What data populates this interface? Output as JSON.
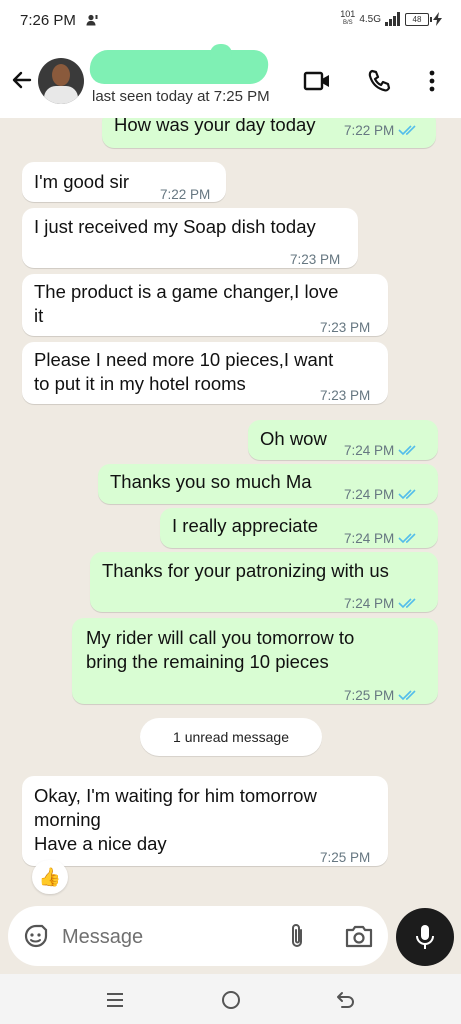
{
  "status_bar": {
    "time": "7:26 PM",
    "speed_top": "101",
    "speed_bottom": "B/S",
    "network": "4.5G",
    "battery": "48"
  },
  "header": {
    "last_seen": "last seen today at 7:25 PM",
    "icons": [
      "back-arrow-icon",
      "video-call-icon",
      "phone-icon",
      "more-vert-icon"
    ]
  },
  "messages": [
    {
      "dir": "out",
      "text": "How was your day today",
      "time": "7:22 PM",
      "read": true
    },
    {
      "dir": "in",
      "text": "I'm good sir",
      "time": "7:22 PM"
    },
    {
      "dir": "in",
      "text": "I just received my Soap dish today",
      "time": "7:23 PM"
    },
    {
      "dir": "in",
      "text": "The product is a game changer,I love it",
      "line1": "The product is a game changer,I love",
      "line2": "it",
      "time": "7:23 PM"
    },
    {
      "dir": "in",
      "text": "Please I need more 10 pieces,I want to put it in my hotel rooms",
      "line1": "Please I need more 10 pieces,I want",
      "line2": "to put it in my hotel rooms",
      "time": "7:23 PM"
    },
    {
      "dir": "out",
      "text": "Oh wow",
      "time": "7:24 PM",
      "read": true
    },
    {
      "dir": "out",
      "text": "Thanks you so much Ma",
      "time": "7:24 PM",
      "read": true
    },
    {
      "dir": "out",
      "text": "I really appreciate",
      "time": "7:24 PM",
      "read": true
    },
    {
      "dir": "out",
      "text": "Thanks for your patronizing with us",
      "time": "7:24 PM",
      "read": true
    },
    {
      "dir": "out",
      "text": "My rider will call you tomorrow to bring the remaining 10 pieces",
      "line1": "My rider will call you tomorrow to",
      "line2": "bring the remaining 10 pieces",
      "time": "7:25 PM",
      "read": true
    },
    {
      "dir": "in",
      "text": "Okay, I'm waiting for him tomorrow morning Have a nice day",
      "line1": "Okay, I'm waiting for him tomorrow",
      "line2": "morning",
      "line3": "Have a nice day",
      "time": "7:25 PM"
    }
  ],
  "unread_divider": "1 unread message",
  "reaction": "👍",
  "input": {
    "placeholder": "Message"
  },
  "colors": {
    "outgoing_bubble": "#d9fdd3",
    "incoming_bubble": "#ffffff",
    "background": "#efeae2",
    "read_tick": "#53bdeb"
  },
  "nav": {
    "icons": [
      "recents-icon",
      "home-icon",
      "back-icon"
    ]
  }
}
